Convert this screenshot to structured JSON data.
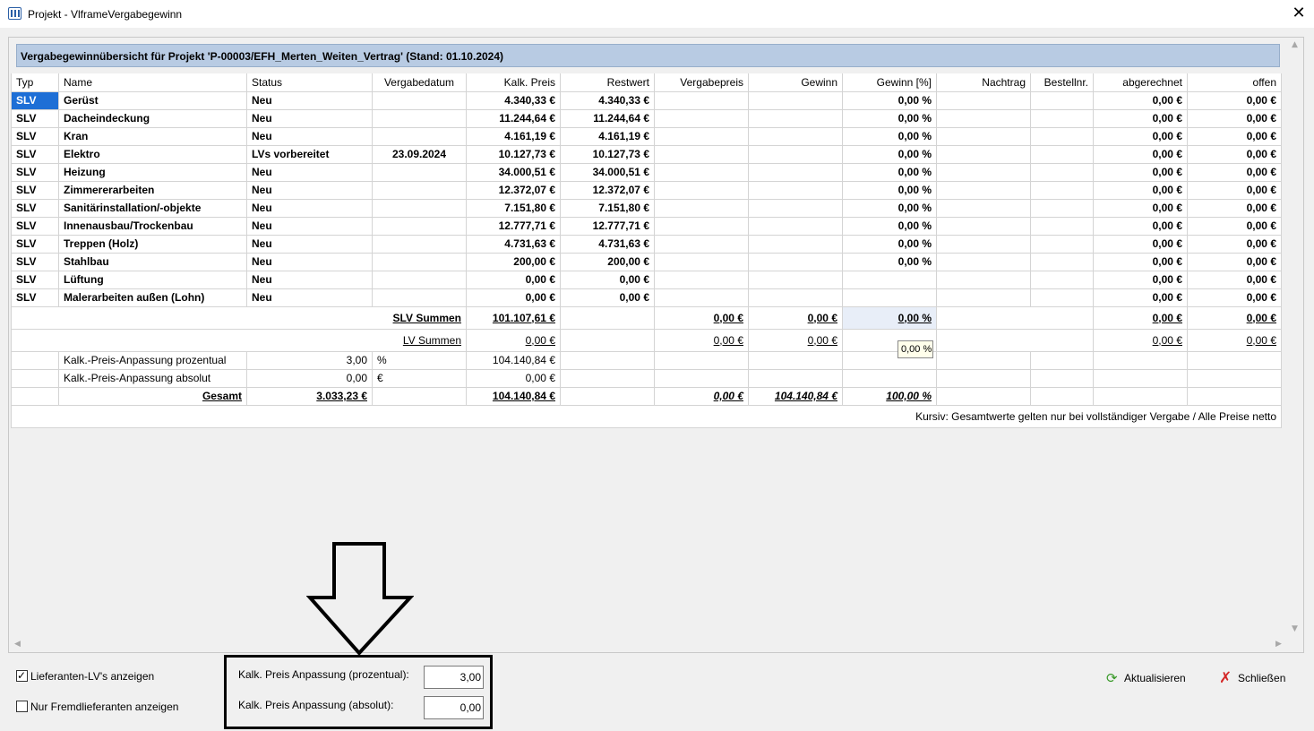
{
  "window": {
    "title": "Projekt - VlframeVergabegewinn",
    "close_glyph": "✕"
  },
  "heading": "Vergabegewinnübersicht für Projekt 'P-00003/EFH_Merten_Weiten_Vertrag' (Stand: 01.10.2024)",
  "columns": [
    "Typ",
    "Name",
    "Status",
    "Vergabedatum",
    "Kalk. Preis",
    "Restwert",
    "Vergabepreis",
    "Gewinn",
    "Gewinn [%]",
    "Nachtrag",
    "Bestellnr.",
    "abgerechnet",
    "offen"
  ],
  "rows": [
    {
      "typ": "SLV",
      "name": "Gerüst",
      "status": "Neu",
      "datum": "",
      "kalk": "4.340,33 €",
      "rest": "4.340,33 €",
      "vergabe": "",
      "gewinn": "",
      "pct": "0,00 %",
      "nachtrag": "",
      "bestell": "",
      "abger": "0,00 €",
      "offen": "0,00 €"
    },
    {
      "typ": "SLV",
      "name": "Dacheindeckung",
      "status": "Neu",
      "datum": "",
      "kalk": "11.244,64 €",
      "rest": "11.244,64 €",
      "vergabe": "",
      "gewinn": "",
      "pct": "0,00 %",
      "nachtrag": "",
      "bestell": "",
      "abger": "0,00 €",
      "offen": "0,00 €"
    },
    {
      "typ": "SLV",
      "name": "Kran",
      "status": "Neu",
      "datum": "",
      "kalk": "4.161,19 €",
      "rest": "4.161,19 €",
      "vergabe": "",
      "gewinn": "",
      "pct": "0,00 %",
      "nachtrag": "",
      "bestell": "",
      "abger": "0,00 €",
      "offen": "0,00 €"
    },
    {
      "typ": "SLV",
      "name": "Elektro",
      "status": "LVs vorbereitet",
      "datum": "23.09.2024",
      "kalk": "10.127,73 €",
      "rest": "10.127,73 €",
      "vergabe": "",
      "gewinn": "",
      "pct": "0,00 %",
      "nachtrag": "",
      "bestell": "",
      "abger": "0,00 €",
      "offen": "0,00 €"
    },
    {
      "typ": "SLV",
      "name": "Heizung",
      "status": "Neu",
      "datum": "",
      "kalk": "34.000,51 €",
      "rest": "34.000,51 €",
      "vergabe": "",
      "gewinn": "",
      "pct": "0,00 %",
      "nachtrag": "",
      "bestell": "",
      "abger": "0,00 €",
      "offen": "0,00 €"
    },
    {
      "typ": "SLV",
      "name": "Zimmererarbeiten",
      "status": "Neu",
      "datum": "",
      "kalk": "12.372,07 €",
      "rest": "12.372,07 €",
      "vergabe": "",
      "gewinn": "",
      "pct": "0,00 %",
      "nachtrag": "",
      "bestell": "",
      "abger": "0,00 €",
      "offen": "0,00 €"
    },
    {
      "typ": "SLV",
      "name": "Sanitärinstallation/-objekte",
      "status": "Neu",
      "datum": "",
      "kalk": "7.151,80 €",
      "rest": "7.151,80 €",
      "vergabe": "",
      "gewinn": "",
      "pct": "0,00 %",
      "nachtrag": "",
      "bestell": "",
      "abger": "0,00 €",
      "offen": "0,00 €"
    },
    {
      "typ": "SLV",
      "name": "Innenausbau/Trockenbau",
      "status": "Neu",
      "datum": "",
      "kalk": "12.777,71 €",
      "rest": "12.777,71 €",
      "vergabe": "",
      "gewinn": "",
      "pct": "0,00 %",
      "nachtrag": "",
      "bestell": "",
      "abger": "0,00 €",
      "offen": "0,00 €"
    },
    {
      "typ": "SLV",
      "name": "Treppen (Holz)",
      "status": "Neu",
      "datum": "",
      "kalk": "4.731,63 €",
      "rest": "4.731,63 €",
      "vergabe": "",
      "gewinn": "",
      "pct": "0,00 %",
      "nachtrag": "",
      "bestell": "",
      "abger": "0,00 €",
      "offen": "0,00 €"
    },
    {
      "typ": "SLV",
      "name": "Stahlbau",
      "status": "Neu",
      "datum": "",
      "kalk": "200,00 €",
      "rest": "200,00 €",
      "vergabe": "",
      "gewinn": "",
      "pct": "0,00 %",
      "nachtrag": "",
      "bestell": "",
      "abger": "0,00 €",
      "offen": "0,00 €"
    },
    {
      "typ": "SLV",
      "name": "Lüftung",
      "status": "Neu",
      "datum": "",
      "kalk": "0,00 €",
      "rest": "0,00 €",
      "vergabe": "",
      "gewinn": "",
      "pct": "",
      "nachtrag": "",
      "bestell": "",
      "abger": "0,00 €",
      "offen": "0,00 €"
    },
    {
      "typ": "SLV",
      "name": "Malerarbeiten außen (Lohn)",
      "status": "Neu",
      "datum": "",
      "kalk": "0,00 €",
      "rest": "0,00 €",
      "vergabe": "",
      "gewinn": "",
      "pct": "",
      "nachtrag": "",
      "bestell": "",
      "abger": "0,00 €",
      "offen": "0,00 €"
    }
  ],
  "slv_summen": {
    "label": "SLV Summen",
    "kalk": "101.107,61 €",
    "vergabe": "0,00 €",
    "gewinn": "0,00 €",
    "pct": "0,00 %",
    "abger": "0,00 €",
    "offen": "0,00 €"
  },
  "lv_summen": {
    "label": "LV Summen",
    "kalk": "0,00 €",
    "vergabe": "0,00 €",
    "gewinn": "0,00 €",
    "abger": "0,00 €",
    "offen": "0,00 €"
  },
  "anpassung_pct": {
    "label": "Kalk.-Preis-Anpassung prozentual",
    "value": "3,00",
    "unit": "%",
    "kalk": "104.140,84 €"
  },
  "anpassung_abs": {
    "label": "Kalk.-Preis-Anpassung absolut",
    "value": "0,00",
    "unit": "€",
    "kalk": "0,00 €"
  },
  "gesamt": {
    "label": "Gesamt",
    "value": "3.033,23 €",
    "kalk": "104.140,84 €",
    "vergabe": "0,00 €",
    "gewinn": "104.140,84 €",
    "pct": "100,00 %"
  },
  "note": "Kursiv: Gesamtwerte gelten nur bei vollständiger Vergabe / Alle Preise netto",
  "tooltip": "0,00 %",
  "options": {
    "show_supplier_lvs": {
      "label": "Lieferanten-LV's anzeigen",
      "checked": true
    },
    "only_external": {
      "label": "Nur Fremdlieferanten anzeigen",
      "checked": false
    }
  },
  "fields": {
    "pct_label": "Kalk. Preis Anpassung (prozentual):",
    "pct_value": "3,00",
    "abs_label": "Kalk. Preis Anpassung (absolut):",
    "abs_value": "0,00"
  },
  "buttons": {
    "refresh": "Aktualisieren",
    "close": "Schließen"
  },
  "icons": {
    "refresh": "refresh-icon",
    "close": "close-icon",
    "arrow": "down-arrow-annotation"
  },
  "colors": {
    "heading_bg": "#b8cbe3",
    "selection": "#1e6fd6",
    "refresh": "#3a9a2a",
    "close": "#d42626"
  }
}
